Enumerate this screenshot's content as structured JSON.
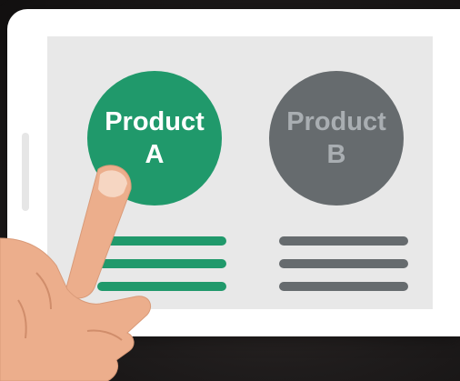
{
  "colors": {
    "selected_product": "#20996b",
    "unselected_product": "#666b6e",
    "unselected_text": "#a9aeb2",
    "screen_bg": "#e8e8e8",
    "tablet_frame": "#ffffff",
    "skin": "#ecae8c"
  },
  "products": [
    {
      "label_line1": "Product",
      "label_line2": "A",
      "selected": true
    },
    {
      "label_line1": "Product",
      "label_line2": "B",
      "selected": false
    }
  ],
  "icons": {
    "hand": "pointing-finger-icon"
  }
}
